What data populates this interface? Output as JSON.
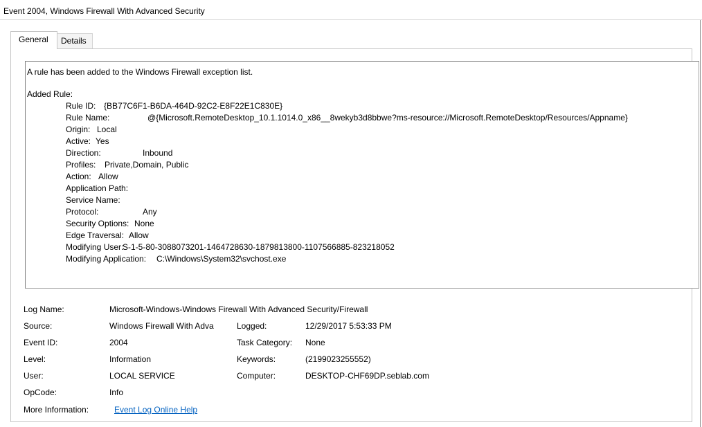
{
  "window": {
    "title": "Event 2004, Windows Firewall With Advanced Security"
  },
  "tabs": [
    {
      "label": "General",
      "selected": true
    },
    {
      "label": "Details",
      "selected": false
    }
  ],
  "description": {
    "summary": "A rule has been added to the Windows Firewall exception list.",
    "header": "Added Rule:",
    "lines": [
      {
        "key": "Rule ID:",
        "value": "{BB77C6F1-B6DA-464D-92C2-E8F22E1C830E}"
      },
      {
        "key": "Rule Name:",
        "value": "@{Microsoft.RemoteDesktop_10.1.1014.0_x86__8wekyb3d8bbwe?ms-resource://Microsoft.RemoteDesktop/Resources/Appname}"
      },
      {
        "key": "Origin:",
        "value": "Local"
      },
      {
        "key": "Active:",
        "value": "Yes"
      },
      {
        "key": "Direction:",
        "value": "Inbound"
      },
      {
        "key": "Profiles:",
        "value": "Private,Domain, Public"
      },
      {
        "key": "Action:",
        "value": "Allow"
      },
      {
        "key": "Application Path:",
        "value": ""
      },
      {
        "key": "Service Name:",
        "value": ""
      },
      {
        "key": "Protocol:",
        "value": "Any"
      },
      {
        "key": "Security Options:",
        "value": "None"
      },
      {
        "key": "Edge Traversal:",
        "value": "Allow"
      },
      {
        "key": "Modifying User:",
        "value": "S-1-5-80-3088073201-1464728630-1879813800-1107566885-823218052"
      },
      {
        "key": "Modifying Application:",
        "value": "C:\\Windows\\System32\\svchost.exe"
      }
    ]
  },
  "meta": {
    "log_name": {
      "label": "Log Name:",
      "value": "Microsoft-Windows-Windows Firewall With Advanced Security/Firewall"
    },
    "source": {
      "label": "Source:",
      "value": "Windows Firewall With Adva"
    },
    "logged": {
      "label": "Logged:",
      "value": "12/29/2017 5:53:33 PM"
    },
    "event_id": {
      "label": "Event ID:",
      "value": "2004"
    },
    "task_category": {
      "label": "Task Category:",
      "value": "None"
    },
    "level": {
      "label": "Level:",
      "value": "Information"
    },
    "keywords": {
      "label": "Keywords:",
      "value": "(2199023255552)"
    },
    "user": {
      "label": "User:",
      "value": "LOCAL SERVICE"
    },
    "computer": {
      "label": "Computer:",
      "value": "DESKTOP-CHF69DP.seblab.com"
    },
    "opcode": {
      "label": "OpCode:",
      "value": "Info"
    },
    "more_info": {
      "label": "More Information:",
      "link": "Event Log Online Help"
    }
  },
  "colors": {
    "link": "#0563c1",
    "border": "#a0a0a0"
  }
}
